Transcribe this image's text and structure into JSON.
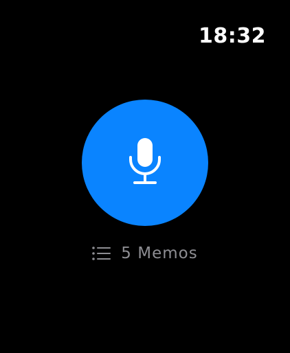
{
  "status_bar": {
    "time": "18:32"
  },
  "recorder": {
    "button_icon": "microphone-icon",
    "button_color": "#0A84FF"
  },
  "memos": {
    "icon": "list-icon",
    "label": "5 Memos",
    "label_color": "#8e8e93"
  }
}
